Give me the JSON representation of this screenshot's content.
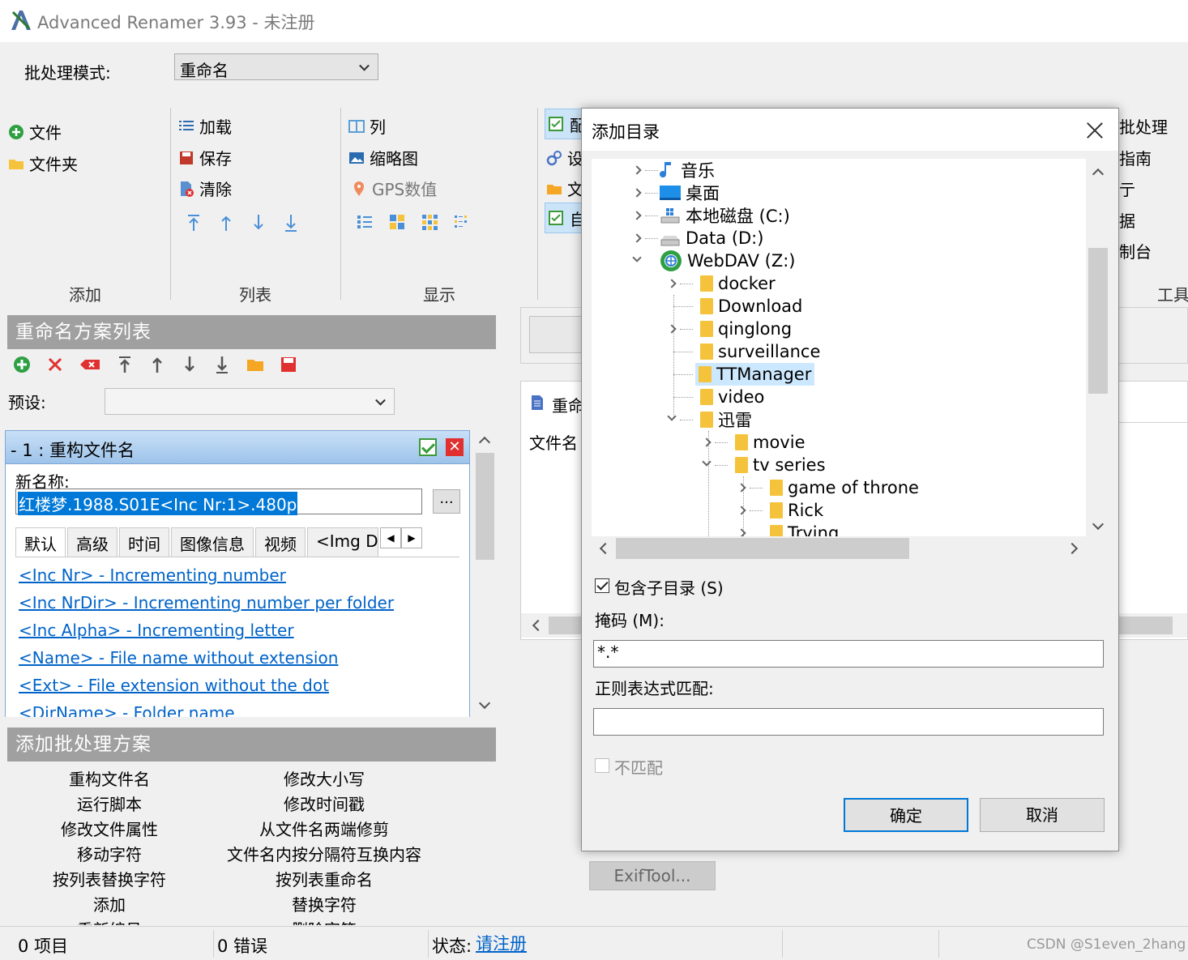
{
  "window": {
    "title": "Advanced Renamer 3.93 - 未注册"
  },
  "batch_mode": {
    "label": "批处理模式:",
    "value": "重命名"
  },
  "ribbon": {
    "add": {
      "group": "添加",
      "file": "文件",
      "folder": "文件夹"
    },
    "list": {
      "group": "列表",
      "load": "加载",
      "save": "保存",
      "clear": "清除"
    },
    "display": {
      "group": "显示",
      "columns": "列",
      "thumbnails": "缩略图",
      "gps": "GPS数值"
    },
    "config": {
      "config": "配",
      "settings": "设",
      "folder": "文",
      "auto": "自"
    },
    "tools": {
      "group": "工具",
      "batch": "批处理",
      "guide": "指南",
      "run": "亍",
      "data": "据",
      "console": "制台"
    }
  },
  "method_list": {
    "header": "重命名方案列表",
    "preset_label": "预设:",
    "preset_value": "",
    "method": {
      "title": "- 1 : 重构文件名",
      "newname_label": "新名称:",
      "newname_value": "红楼梦.1988.S01E<Inc Nr:1>.480p",
      "dots": "...",
      "tabs": [
        "默认",
        "高级",
        "时间",
        "图像信息",
        "视频",
        "<Img D"
      ],
      "tags": [
        "<Inc Nr> - Incrementing number",
        "<Inc NrDir> - Incrementing number per folder",
        "<Inc Alpha> - Incrementing letter",
        "<Name> - File name without extension",
        "<Ext> - File extension without the dot",
        "<DirName> - Folder name"
      ]
    }
  },
  "add_methods": {
    "header": "添加批处理方案",
    "left": [
      "重构文件名",
      "运行脚本",
      "修改文件属性",
      "移动字符",
      "按列表替换字符",
      "添加",
      "重新编号"
    ],
    "right": [
      "修改大小写",
      "修改时间戳",
      "从文件名两端修剪",
      "文件名内按分隔符互换内容",
      "按列表重命名",
      "替换字符",
      "删除字符"
    ]
  },
  "right_panel": {
    "rename_label": "重命",
    "filename_label": "文件名",
    "exiftool": "ExifTool..."
  },
  "status": {
    "items": "0 项目",
    "errors": "0 错误",
    "state_label": "状态:",
    "register_link": "请注册",
    "watermark": "CSDN @S1even_2hang"
  },
  "dialog": {
    "title": "添加目录",
    "tree": [
      {
        "label": "音乐",
        "icon": "music-icon"
      },
      {
        "label": "桌面",
        "icon": "desktop-icon"
      },
      {
        "label": "本地磁盘 (C:)",
        "icon": "drive-icon"
      },
      {
        "label": "Data (D:)",
        "icon": "drive-icon"
      },
      {
        "label": "WebDAV (Z:)",
        "icon": "network-drive-icon"
      },
      {
        "label": "docker",
        "icon": "folder-icon"
      },
      {
        "label": "Download",
        "icon": "folder-icon"
      },
      {
        "label": "qinglong",
        "icon": "folder-icon"
      },
      {
        "label": "surveillance",
        "icon": "folder-icon"
      },
      {
        "label": "TTManager",
        "icon": "folder-icon",
        "selected": true
      },
      {
        "label": "video",
        "icon": "folder-icon"
      },
      {
        "label": "迅雷",
        "icon": "folder-icon"
      },
      {
        "label": "movie",
        "icon": "folder-icon"
      },
      {
        "label": "tv series",
        "icon": "folder-icon"
      },
      {
        "label": "game of throne",
        "icon": "folder-icon"
      },
      {
        "label": "Rick",
        "icon": "folder-icon"
      },
      {
        "label": "Trying",
        "icon": "folder-icon"
      }
    ],
    "include_subdirs": "包含子目录 (S)",
    "include_subdirs_checked": true,
    "mask_label": "掩码 (M):",
    "mask_value": "*.*",
    "regex_label": "正则表达式匹配:",
    "regex_value": "",
    "no_match": "不匹配",
    "no_match_checked": false,
    "ok": "确定",
    "cancel": "取消"
  }
}
